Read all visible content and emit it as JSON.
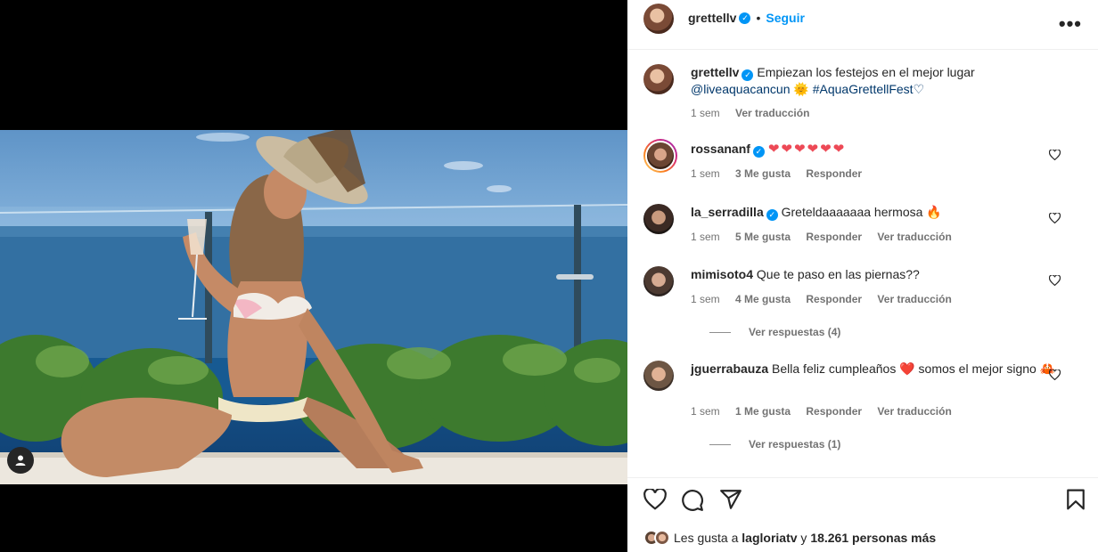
{
  "post": {
    "username": "grettellv",
    "follow_label": "Seguir",
    "more_label": "•••"
  },
  "caption": {
    "username": "grettellv",
    "text": "Empiezan los festejos en el mejor lugar",
    "mention": "@liveaquacancun",
    "emoji": "🌞",
    "hashtag": "#AquaGrettellFest♡",
    "time": "1 sem",
    "translate": "Ver traducción"
  },
  "comments": [
    {
      "username": "rossananf",
      "verified": true,
      "text": "❤❤❤❤❤❤",
      "time": "1 sem",
      "likes": "3 Me gusta",
      "reply": "Responder",
      "translate": ""
    },
    {
      "username": "la_serradilla",
      "verified": true,
      "text": "Greteldaaaaaaa hermosa 🔥",
      "time": "1 sem",
      "likes": "5 Me gusta",
      "reply": "Responder",
      "translate": "Ver traducción"
    },
    {
      "username": "mimisoto4",
      "verified": false,
      "text": "Que te paso en las piernas??",
      "time": "1 sem",
      "likes": "4 Me gusta",
      "reply": "Responder",
      "translate": "Ver traducción",
      "view_replies": "Ver respuestas (4)"
    },
    {
      "username": "jguerrabauza",
      "verified": false,
      "text": "Bella feliz cumpleaños ❤️ somos el mejor signo 🦀",
      "time": "1 sem",
      "likes": "1 Me gusta",
      "reply": "Responder",
      "translate": "Ver traducción",
      "view_replies": "Ver respuestas (1)"
    }
  ],
  "likes_line": {
    "prefix": "Les gusta a",
    "user": "lagloriatv",
    "joiner": "y",
    "count": "18.261 personas más"
  },
  "icons": [
    "heart-icon",
    "comment-icon",
    "share-icon",
    "bookmark-icon",
    "tag-user-icon",
    "verified-badge-icon",
    "more-options-icon"
  ],
  "colors": {
    "link_blue": "#0095f6",
    "verified": "#0095f6",
    "heart_red": "#ed4956",
    "muted": "#737373"
  }
}
